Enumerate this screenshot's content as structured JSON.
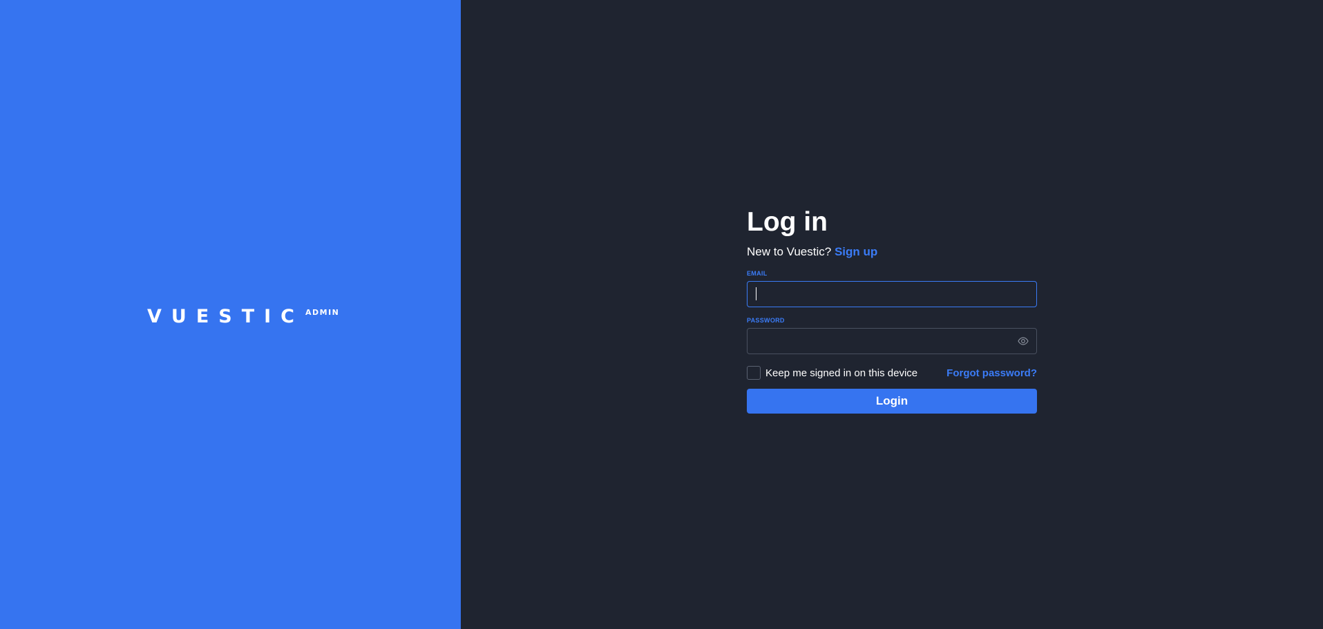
{
  "brand": {
    "logo_text": "VUESTIC",
    "logo_sub": "ADMIN"
  },
  "login": {
    "title": "Log in",
    "subtitle_prefix": "New to Vuestic?",
    "signup_link": "Sign up",
    "email_label": "EMAIL",
    "email_value": "",
    "password_label": "PASSWORD",
    "password_value": "",
    "remember_label": "Keep me signed in on this device",
    "remember_checked": false,
    "forgot_link": "Forgot password?",
    "login_button": "Login"
  },
  "icons": {
    "password_toggle": "eye-icon"
  },
  "colors": {
    "brand_blue": "#3674f0",
    "panel_dark": "#1f2430",
    "link_blue": "#3b7cf7"
  }
}
